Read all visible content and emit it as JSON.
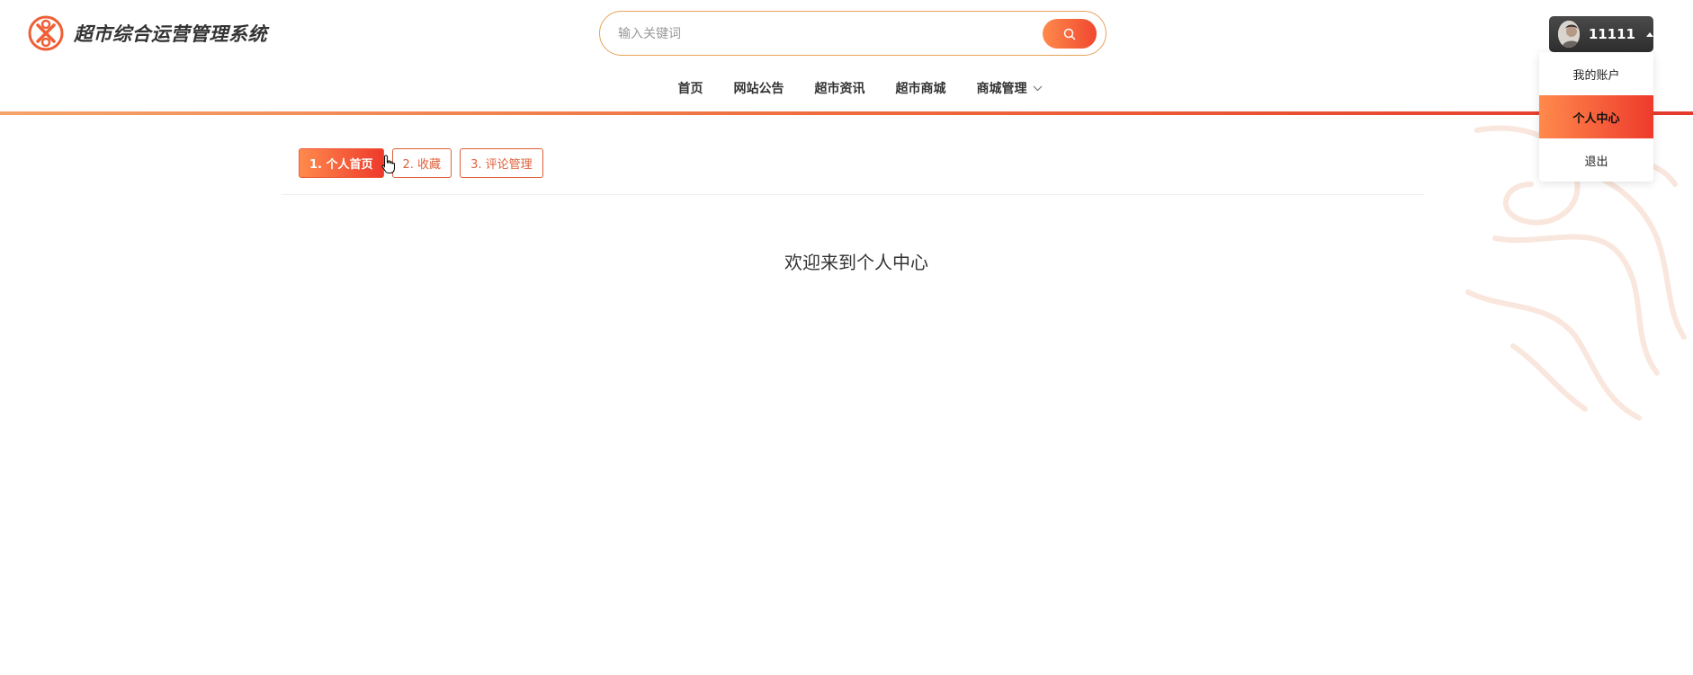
{
  "app": {
    "title": "超市综合运营管理系统"
  },
  "search": {
    "placeholder": "输入关键词"
  },
  "nav": {
    "items": [
      {
        "label": "首页"
      },
      {
        "label": "网站公告"
      },
      {
        "label": "超市资讯"
      },
      {
        "label": "超市商城"
      },
      {
        "label": "商城管理"
      }
    ]
  },
  "user": {
    "name": "11111",
    "menu": [
      {
        "label": "我的账户"
      },
      {
        "label": "个人中心",
        "active": true
      },
      {
        "label": "退出"
      }
    ]
  },
  "tabs": [
    {
      "label": "1. 个人首页",
      "active": true
    },
    {
      "label": "2. 收藏"
    },
    {
      "label": "3. 评论管理"
    }
  ],
  "main": {
    "welcome": "欢迎来到个人中心"
  },
  "colors": {
    "accent": "#ee3a2c",
    "accent_light": "#ff8a4c",
    "border_accent": "#e6a35a"
  },
  "icons": [
    "logo-icon",
    "search-icon",
    "chevron-down-icon",
    "caret-up-icon",
    "dragon-watermark-icon",
    "pointer-cursor-icon"
  ]
}
